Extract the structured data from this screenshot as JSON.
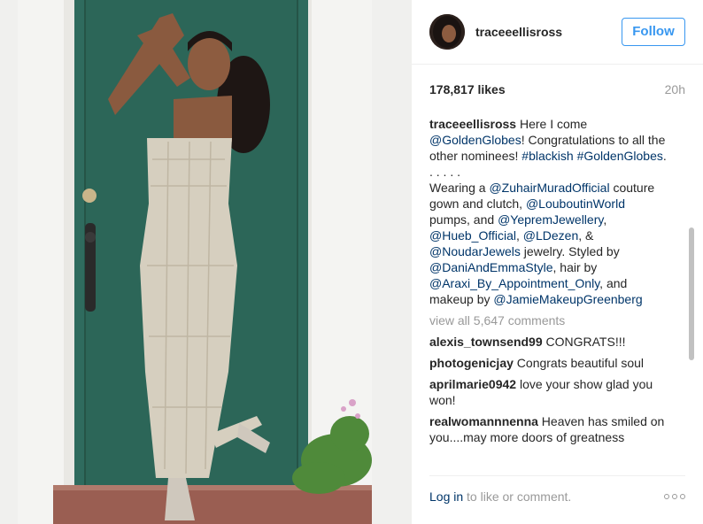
{
  "post": {
    "username": "traceeellisross",
    "follow_label": "Follow",
    "likes": "178,817 likes",
    "time": "20h"
  },
  "caption": {
    "segments": [
      {
        "t": "Here I come "
      },
      {
        "t": "@GoldenGlobes",
        "l": 1
      },
      {
        "t": "! Congratulations to all the other nominees! "
      },
      {
        "t": "#blackish",
        "l": 1
      },
      {
        "t": " "
      },
      {
        "t": "#GoldenGlobes",
        "l": 1
      },
      {
        "t": "."
      }
    ],
    "dots": ". . . . .",
    "body": [
      {
        "t": "Wearing a "
      },
      {
        "t": "@ZuhairMuradOfficial",
        "l": 1
      },
      {
        "t": " couture gown and clutch, "
      },
      {
        "t": "@LouboutinWorld",
        "l": 1
      },
      {
        "t": " pumps, and "
      },
      {
        "t": "@YepremJewellery",
        "l": 1
      },
      {
        "t": ", "
      },
      {
        "t": "@Hueb_Official",
        "l": 1
      },
      {
        "t": ", "
      },
      {
        "t": "@LDezen",
        "l": 1
      },
      {
        "t": ", & "
      },
      {
        "t": "@NoudarJewels",
        "l": 1
      },
      {
        "t": " jewelry. Styled by "
      },
      {
        "t": "@DaniAndEmmaStyle",
        "l": 1
      },
      {
        "t": ", hair by "
      },
      {
        "t": "@Araxi_By_Appointment_Only",
        "l": 1
      },
      {
        "t": ", and makeup by "
      },
      {
        "t": "@JamieMakeupGreenberg",
        "l": 1
      }
    ]
  },
  "view_all": "view all 5,647 comments",
  "comments": [
    {
      "user": "alexis_townsend99",
      "text": "CONGRATS!!!"
    },
    {
      "user": "photogenicjay",
      "text": "Congrats beautiful soul"
    },
    {
      "user": "aprilmarie0942",
      "text": "love your show glad you won!"
    },
    {
      "user": "realwomannnenna",
      "text": "Heaven has smiled on you....may more doors of greatness"
    }
  ],
  "footer": {
    "login_link": "Log in",
    "login_rest": " to like or comment."
  },
  "icons": {
    "more": "more-options-icon"
  },
  "colors": {
    "accent": "#3897f0",
    "link": "#003569",
    "muted": "#999999",
    "door": "#2f6b5e"
  }
}
